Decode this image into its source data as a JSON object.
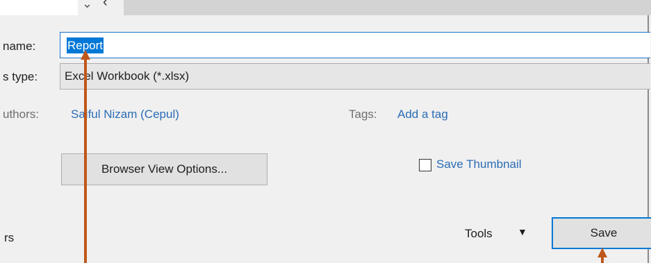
{
  "nav": {
    "dropdown_icon": "chevron-down-icon",
    "back_icon": "chevron-left-icon"
  },
  "form": {
    "name_label": "name:",
    "name_value": "Report",
    "type_label": "s type:",
    "type_value": "Excel Workbook (*.xlsx)",
    "authors_label": "uthors:",
    "authors_value": "Saiful Nizam (Cepul)",
    "tags_label": "Tags:",
    "tags_value": "Add a tag"
  },
  "options": {
    "browser_view_label": "Browser View Options...",
    "save_thumbnail_label": "Save Thumbnail",
    "save_thumbnail_checked": false
  },
  "footer": {
    "left_text": "rs",
    "tools_label": "Tools",
    "tools_caret": "▼",
    "save_label": "Save"
  },
  "colors": {
    "accent": "#0078d7",
    "link": "#2b6cb4",
    "annotation": "#c0571b"
  }
}
